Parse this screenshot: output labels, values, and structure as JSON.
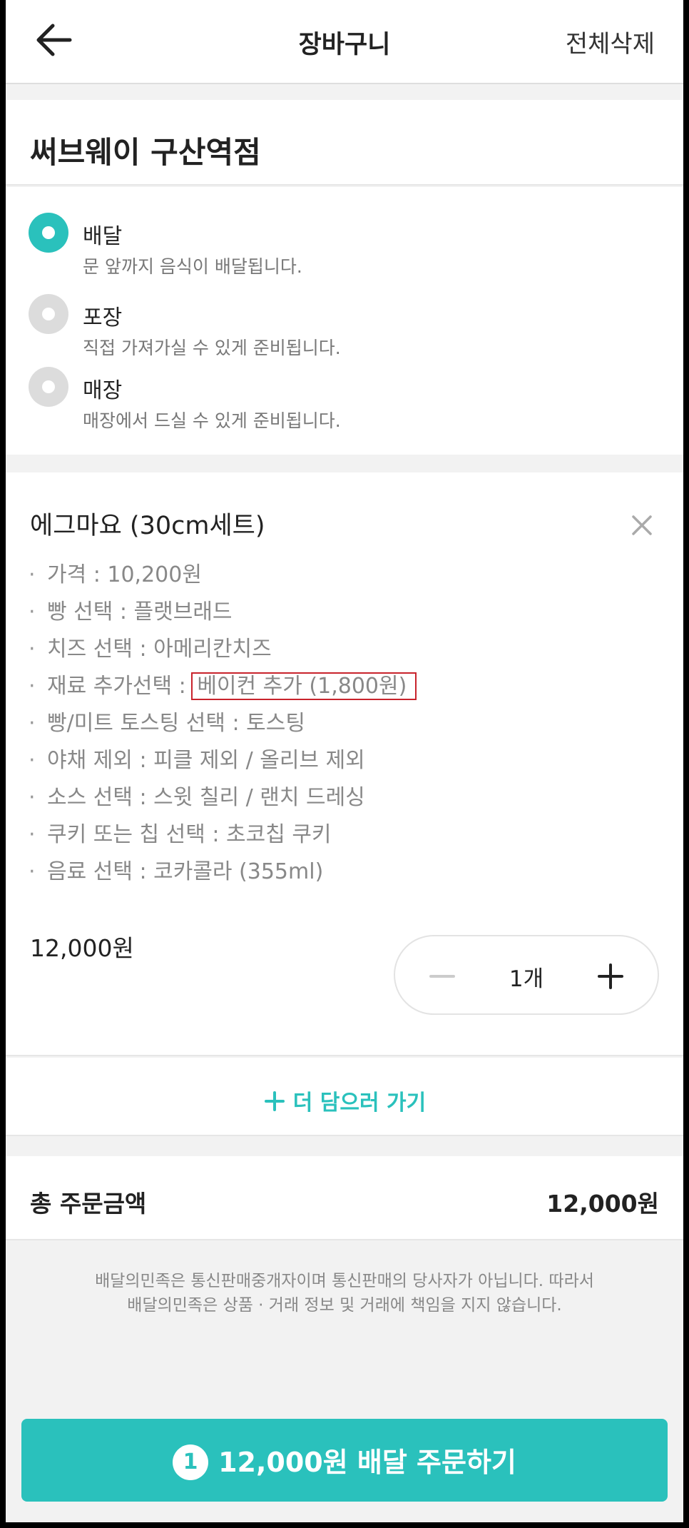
{
  "header": {
    "title": "장바구니",
    "delete_all": "전체삭제"
  },
  "store": {
    "name": "써브웨이 구산역점"
  },
  "order_types": [
    {
      "label": "배달",
      "desc": "문 앞까지 음식이 배달됩니다.",
      "selected": true
    },
    {
      "label": "포장",
      "desc": "직접 가져가실 수 있게 준비됩니다.",
      "selected": false
    },
    {
      "label": "매장",
      "desc": "매장에서 드실 수 있게 준비됩니다.",
      "selected": false
    }
  ],
  "item": {
    "name": "에그마요 (30cm세트)",
    "details": [
      "가격 : 10,200원",
      "빵 선택 : 플랫브래드",
      "치즈 선택 : 아메리칸치즈",
      "재료 추가선택 : ",
      "빵/미트 토스팅 선택 : 토스팅",
      "야채 제외 : 피클 제외 / 올리브 제외",
      "소스 선택 : 스윗 칠리 / 랜치 드레싱",
      "쿠키 또는 칩 선택 : 초코칩 쿠키",
      "음료 선택 : 코카콜라 (355ml)"
    ],
    "highlighted_option": "베이컨 추가 (1,800원)",
    "price": "12,000원",
    "quantity": "1개"
  },
  "add_more": {
    "label": "더 담으러 가기"
  },
  "total": {
    "label": "총 주문금액",
    "value": "12,000원"
  },
  "notice": {
    "line1": "배달의민족은 통신판매중개자이며 통신판매의 당사자가 아닙니다. 따라서",
    "line2": "배달의민족은 상품 · 거래 정보 및 거래에 책임을 지지 않습니다."
  },
  "order_button": {
    "count": "1",
    "label": "12,000원 배달 주문하기"
  },
  "colors": {
    "accent": "#2ac1bc",
    "highlight_border": "#c8232c"
  }
}
